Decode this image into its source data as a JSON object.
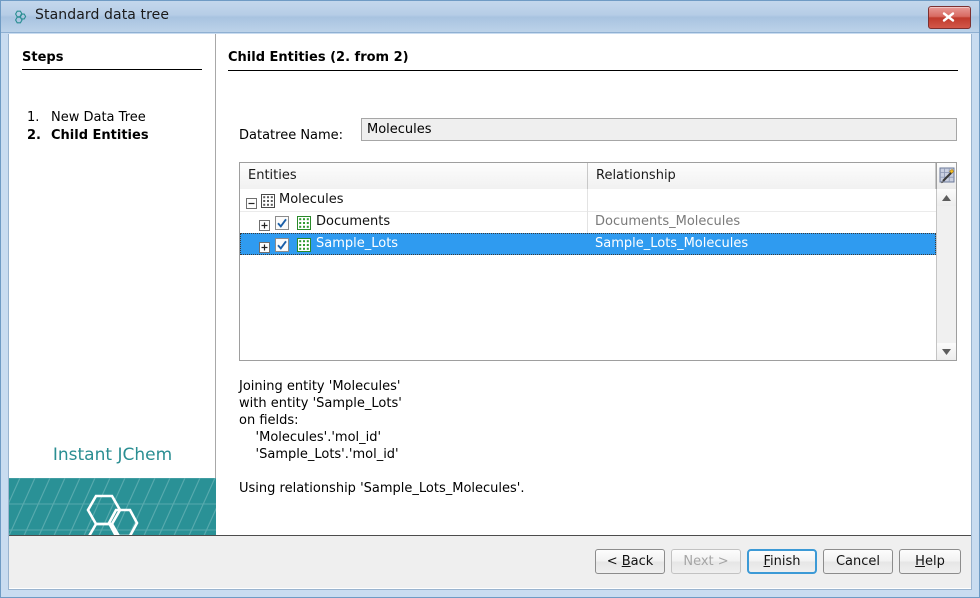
{
  "window": {
    "title": "Standard data tree",
    "icon": "molecule-icon",
    "close_label": "close-icon"
  },
  "steps_panel": {
    "heading": "Steps",
    "items": [
      {
        "num": "1.",
        "label": "New Data Tree",
        "current": false
      },
      {
        "num": "2.",
        "label": "Child Entities",
        "current": true
      }
    ],
    "brand_text": "Instant JChem",
    "brand_color": "#2a9196",
    "brand_text_color": "#2a8e92"
  },
  "content": {
    "page_title": "Child Entities (2. from 2)",
    "datatree": {
      "label": "Datatree Name:",
      "value": "Molecules",
      "placeholder": ""
    },
    "table": {
      "columns": [
        "Entities",
        "Relationship"
      ],
      "corner_button": "column-chooser-icon",
      "rows": [
        {
          "indent": 0,
          "twisty": "minus",
          "checkbox": null,
          "icon": "grid-icon-gray",
          "entity": "Molecules",
          "relationship": "",
          "selected": false
        },
        {
          "indent": 1,
          "twisty": "plus",
          "checkbox": "checked",
          "icon": "grid-icon-green",
          "entity": "Documents",
          "relationship": "Documents_Molecules",
          "selected": false
        },
        {
          "indent": 1,
          "twisty": "plus",
          "checkbox": "checked",
          "icon": "grid-icon-green",
          "entity": "Sample_Lots",
          "relationship": "Sample_Lots_Molecules",
          "selected": true
        }
      ],
      "selection_color": "#2f9bf0"
    },
    "description": "Joining entity 'Molecules'\nwith entity 'Sample_Lots'\non fields:\n    'Molecules'.'mol_id'\n    'Sample_Lots'.'mol_id'\n\nUsing relationship 'Sample_Lots_Molecules'."
  },
  "buttons": [
    {
      "id": "back",
      "label": "< Back",
      "mnemonic": "B",
      "disabled": false,
      "default": false
    },
    {
      "id": "next",
      "label": "Next >",
      "mnemonic": "",
      "disabled": true,
      "default": false
    },
    {
      "id": "finish",
      "label": "Finish",
      "mnemonic": "F",
      "disabled": false,
      "default": true
    },
    {
      "id": "cancel",
      "label": "Cancel",
      "mnemonic": "",
      "disabled": false,
      "default": false
    },
    {
      "id": "help",
      "label": "Help",
      "mnemonic": "H",
      "disabled": false,
      "default": false
    }
  ]
}
